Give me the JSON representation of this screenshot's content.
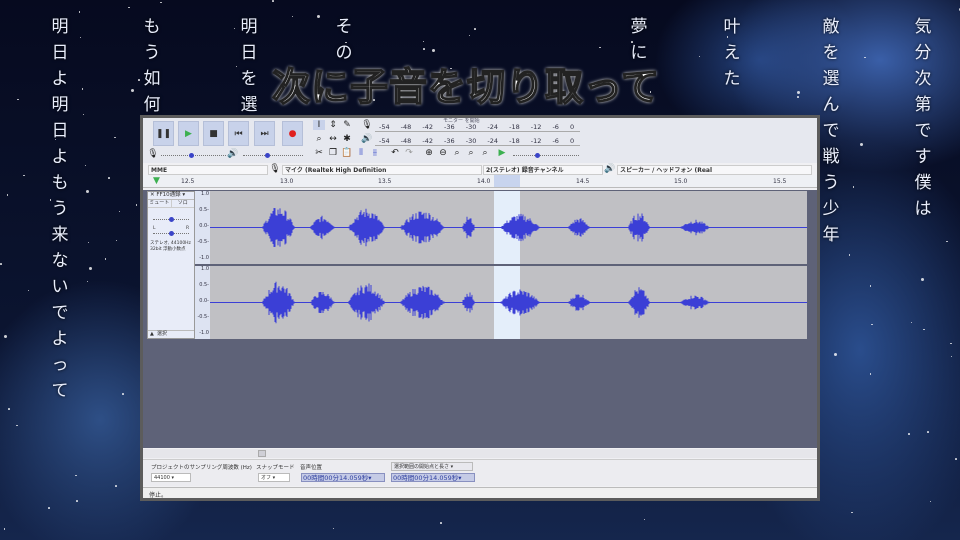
{
  "caption": "次に子音を切り取って",
  "lyrics": [
    "明日よ明日よもう来ないでよって",
    "もう如何",
    "明日を選",
    "その",
    "夢に",
    "叶えた",
    "敵を選んで戦う少年",
    "気分次第です僕は"
  ],
  "audacity": {
    "transport": {
      "pause": "❚❚",
      "play": "▶",
      "stop": "■",
      "skip_start": "⏮",
      "skip_end": "⏭",
      "record": "●"
    },
    "meters": {
      "record_meter": "-54 -48 -42 -36 -30 -24 -18 -12 -6 0",
      "monitor_label": "モニター を開始",
      "playback_meter": "-54 -48 -42 -36 -30 -24 -18 -12 -6 0"
    },
    "devices": {
      "host": "MME",
      "mic": "マイク (Realtek High Definition",
      "channels": "2(ステレオ) 録音チャンネル",
      "speaker": "スピーカー / ヘッドフォン (Real"
    },
    "ruler": [
      "12.5",
      "13.0",
      "13.5",
      "14.0",
      "14.5",
      "15.0",
      "15.5"
    ],
    "track": {
      "name": "FF10通録",
      "mute": "ミュート",
      "solo": "ソロ",
      "pan_l": "L",
      "pan_r": "R",
      "info": "ステレオ, 44100Hz 32bit 浮動小数点",
      "select": "選択",
      "scale": [
        "1.0",
        "0.5-",
        "0.0-",
        "-0.5-",
        "-1.0"
      ]
    },
    "selection_toolbar": {
      "rate_label": "プロジェクトのサンプリング周波数 (Hz)",
      "rate_value": "44100",
      "snap_label": "スナップモード",
      "snap_value": "オフ",
      "pos_label": "音声位置",
      "pos_value": "00時間00分14.059秒",
      "sel_mode": "選択範囲の開始点と長さ",
      "sel_value": "00時間00分14.059秒"
    },
    "status": "停止。"
  },
  "colors": {
    "waveform": "#3b3fd6",
    "selection": "#e4eefa",
    "track_bg": "#c0c0c4"
  }
}
